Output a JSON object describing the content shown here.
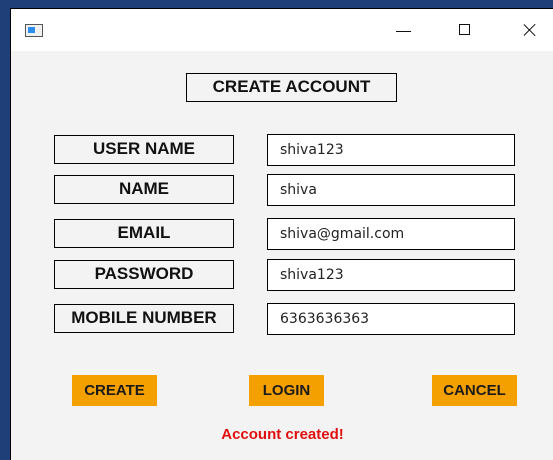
{
  "window": {
    "icon": "app-window-icon",
    "controls": {
      "minimize_icon": "minimize-icon",
      "maximize_icon": "maximize-icon",
      "close_icon": "close-icon"
    }
  },
  "form": {
    "title": "CREATE ACCOUNT",
    "fields": [
      {
        "label": "USER NAME",
        "value": "shiva123"
      },
      {
        "label": "NAME",
        "value": "shiva"
      },
      {
        "label": "EMAIL",
        "value": "shiva@gmail.com"
      },
      {
        "label": "PASSWORD",
        "value": "shiva123"
      },
      {
        "label": "MOBILE NUMBER",
        "value": "6363636363"
      }
    ]
  },
  "actions": {
    "create": "CREATE",
    "login": "LOGIN",
    "cancel": "CANCEL"
  },
  "status": {
    "message": "Account created!"
  },
  "colors": {
    "button_bg": "#f3a000",
    "status_text": "#e01010",
    "window_bg": "#f3f3f3"
  }
}
